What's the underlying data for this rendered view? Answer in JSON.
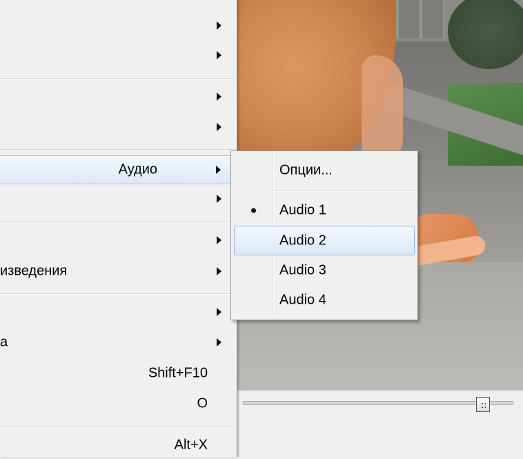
{
  "main_menu": {
    "items": [
      {
        "label": "",
        "has_submenu": true
      },
      {
        "label": "",
        "has_submenu": true
      },
      {
        "label": "",
        "has_submenu": true
      },
      {
        "label": "",
        "has_submenu": true
      },
      {
        "label": "Аудио",
        "has_submenu": true,
        "highlighted": true
      },
      {
        "label": "",
        "has_submenu": true
      },
      {
        "label": "",
        "has_submenu": true
      },
      {
        "label": "изведения",
        "has_submenu": true
      },
      {
        "label": "",
        "has_submenu": true
      },
      {
        "label": "а",
        "has_submenu": true
      },
      {
        "label": "",
        "shortcut": "Shift+F10"
      },
      {
        "label": "",
        "shortcut": "O"
      },
      {
        "label": "",
        "shortcut": "Alt+X"
      }
    ]
  },
  "audio_submenu": {
    "options_label": "Опции...",
    "tracks": [
      {
        "label": "Audio 1",
        "selected": true
      },
      {
        "label": "Audio 2",
        "highlighted": true
      },
      {
        "label": "Audio 3"
      },
      {
        "label": "Audio 4"
      }
    ]
  },
  "colors": {
    "menu_bg": "#f0f0f0",
    "highlight": "#dde9f7",
    "highlight_border": "#a8c6ea"
  }
}
